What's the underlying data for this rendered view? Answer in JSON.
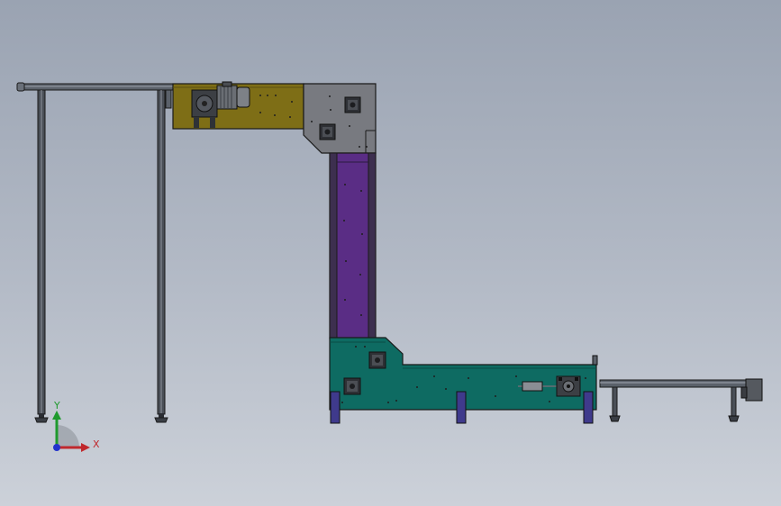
{
  "view": {
    "background_top": "#9aa3b2",
    "background_bottom": "#ccd1d9"
  },
  "triad": {
    "x_label": "X",
    "y_label": "Y",
    "x_color": "#c0282d",
    "y_color": "#1f9a2e",
    "z_color": "#2233cc"
  },
  "colors": {
    "top_conveyor_panel": "#7e6e16",
    "corner_housing": "#787a80",
    "vertical_section": "#5a2d85",
    "vertical_rail": "#3d2f4f",
    "bottom_conveyor": "#0e6b62",
    "legs": "#3f3a8c",
    "frame_tube": "#4a4f57",
    "motor": "#6a6e74",
    "outline": "#1a1a1a"
  },
  "parts": [
    "overhead-frame",
    "top-conveyor-drive",
    "upper-corner-housing",
    "vertical-lift-section",
    "lower-corner-housing",
    "bottom-conveyor",
    "outfeed-belt-conveyor"
  ]
}
